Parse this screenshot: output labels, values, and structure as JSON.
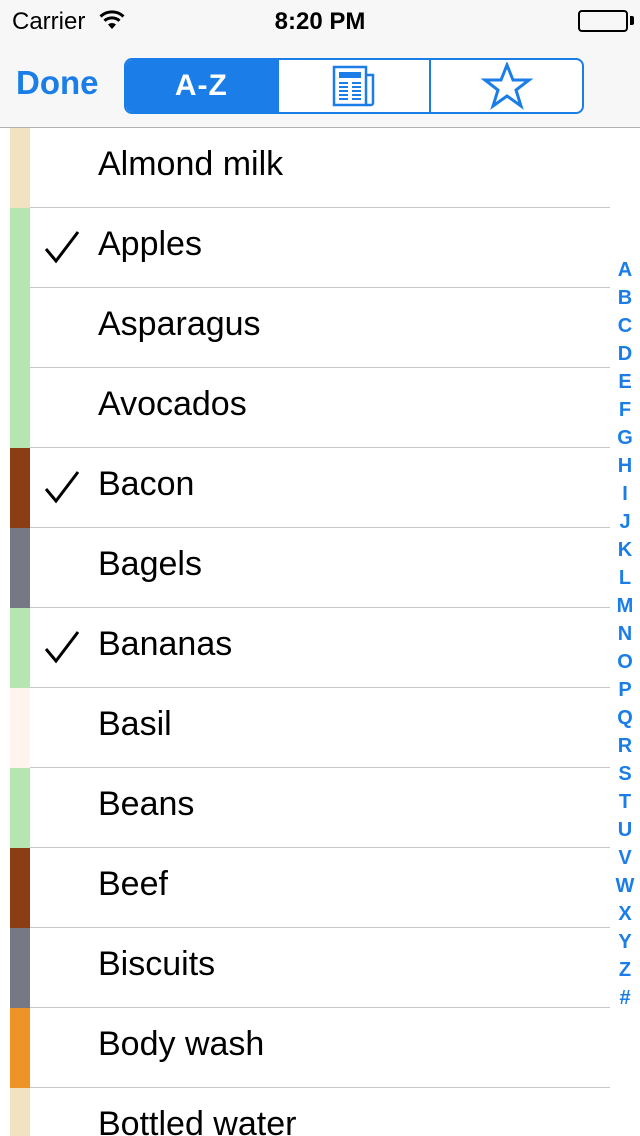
{
  "status_bar": {
    "carrier": "Carrier",
    "time": "8:20 PM",
    "icons": [
      "wifi-icon",
      "battery-icon"
    ]
  },
  "nav": {
    "done_label": "Done",
    "segments": [
      {
        "label": "A-Z",
        "icon": null,
        "selected": true
      },
      {
        "label": null,
        "icon": "newspaper-icon",
        "selected": false
      },
      {
        "label": null,
        "icon": "star-icon",
        "selected": false
      }
    ]
  },
  "colors": {
    "accent": "#1a7de8"
  },
  "items": [
    {
      "name": "Almond milk",
      "checked": false,
      "color": "#f2e3c0"
    },
    {
      "name": "Apples",
      "checked": true,
      "color": "#b5e6b1"
    },
    {
      "name": "Asparagus",
      "checked": false,
      "color": "#b5e6b1"
    },
    {
      "name": "Avocados",
      "checked": false,
      "color": "#b5e6b1"
    },
    {
      "name": "Bacon",
      "checked": true,
      "color": "#8b3d14"
    },
    {
      "name": "Bagels",
      "checked": false,
      "color": "#767884"
    },
    {
      "name": "Bananas",
      "checked": true,
      "color": "#b5e6b1"
    },
    {
      "name": "Basil",
      "checked": false,
      "color": "#fff4ee"
    },
    {
      "name": "Beans",
      "checked": false,
      "color": "#b5e6b1"
    },
    {
      "name": "Beef",
      "checked": false,
      "color": "#8b3d14"
    },
    {
      "name": "Biscuits",
      "checked": false,
      "color": "#767884"
    },
    {
      "name": "Body wash",
      "checked": false,
      "color": "#ee9326"
    },
    {
      "name": "Bottled water",
      "checked": false,
      "color": "#f2e3c0"
    }
  ],
  "index_letters": [
    "A",
    "B",
    "C",
    "D",
    "E",
    "F",
    "G",
    "H",
    "I",
    "J",
    "K",
    "L",
    "M",
    "N",
    "O",
    "P",
    "Q",
    "R",
    "S",
    "T",
    "U",
    "V",
    "W",
    "X",
    "Y",
    "Z",
    "#"
  ]
}
